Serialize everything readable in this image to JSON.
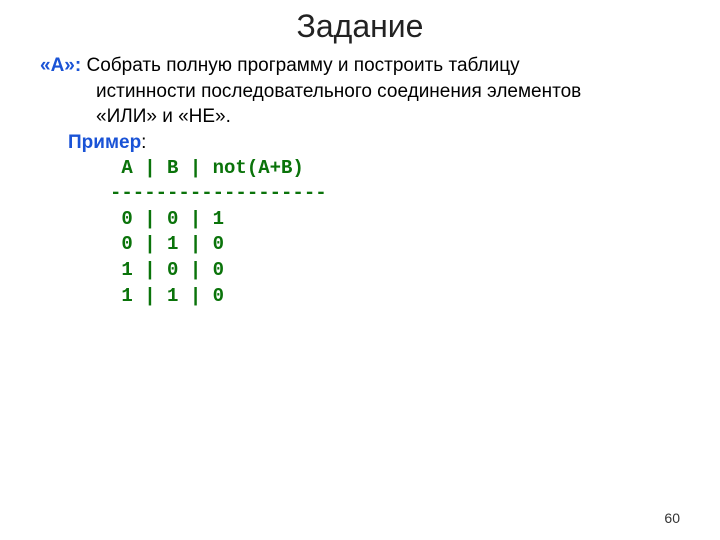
{
  "title": "Задание",
  "label_a": "«A»:",
  "desc_first": " Собрать полную программу и построить таблицу",
  "desc_cont1": "истинности последовательного соединения элементов",
  "desc_cont2": "«ИЛИ» и «НЕ».",
  "example_label": "Пример",
  "colon": ":",
  "code": {
    "l1": " A | B | not(A+B)",
    "l2": "-------------------",
    "l3": " 0 | 0 | 1",
    "l4": " 0 | 1 | 0",
    "l5": " 1 | 0 | 0",
    "l6": " 1 | 1 | 0"
  },
  "page_number": "60"
}
